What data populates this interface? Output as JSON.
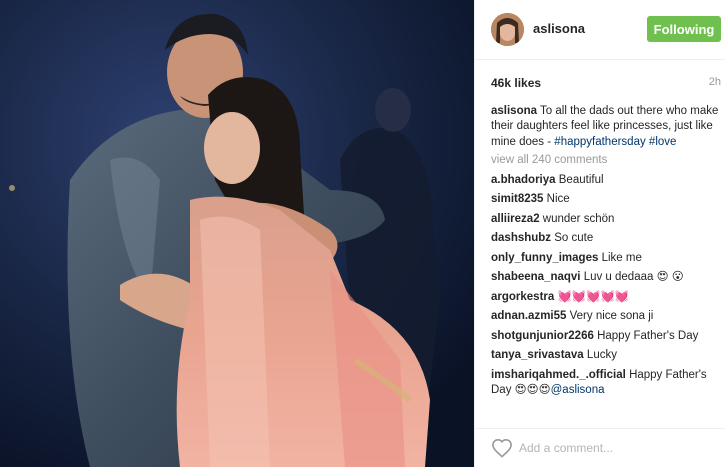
{
  "post": {
    "photo_description": "photo-of-father-hugging-daughter",
    "author": "aslisona",
    "follow_label": "Following",
    "likes": "46k likes",
    "time": "2h",
    "caption": {
      "user": "aslisona",
      "text": "To all the dads out there who make their daughters feel like princesses, just like mine does -",
      "tags": "#happyfathersday #love"
    },
    "view_all": "view all 240 comments",
    "comments": [
      {
        "user": "a.bhadoriya",
        "text": "Beautiful"
      },
      {
        "user": "simit8235",
        "text": "Nice"
      },
      {
        "user": "alliireza2",
        "text": "wunder schön"
      },
      {
        "user": "dashshubz",
        "text": "So cute"
      },
      {
        "user": "only_funny_images",
        "text": "Like me"
      },
      {
        "user": "shabeena_naqvi",
        "text": "Luv u dedaaa 😍 😮"
      },
      {
        "user": "argorkestra",
        "text": "💓💓💓💓💓"
      },
      {
        "user": "adnan.azmi55",
        "text": "Very nice sona ji"
      },
      {
        "user": "shotgunjunior2266",
        "text": "Happy Father's Day"
      },
      {
        "user": "tanya_srivastava",
        "text": "Lucky"
      },
      {
        "user": "imshariqahmed._.official",
        "text": "Happy Father's Day 😍😍😍",
        "mention": "@aslisona"
      }
    ],
    "add_comment_placeholder": "Add a comment...",
    "icons": {
      "like": "heart-outline-icon"
    }
  },
  "colors": {
    "follow_green": "#70c050",
    "link_blue": "#003569",
    "muted": "#999999"
  }
}
